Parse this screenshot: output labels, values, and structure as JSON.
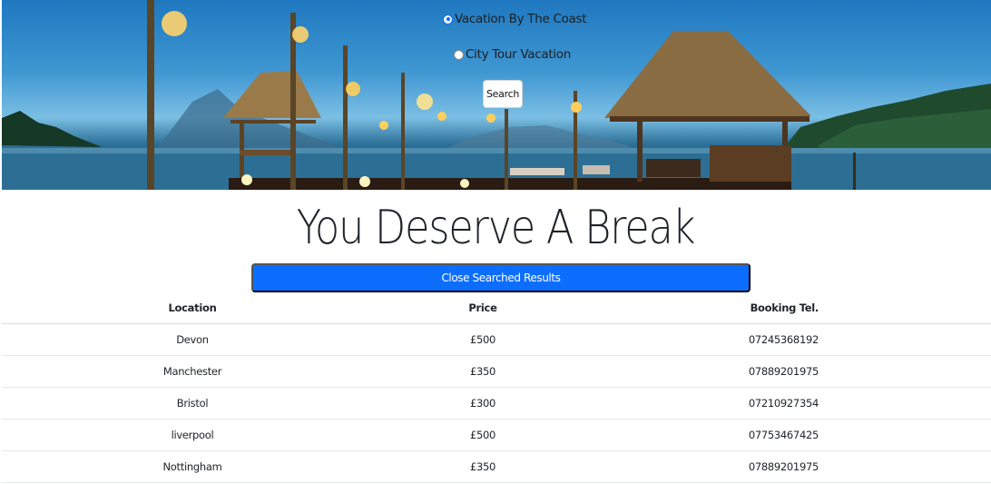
{
  "hero": {
    "options": [
      {
        "label": "Vacation By The Coast",
        "checked": true
      },
      {
        "label": "City Tour Vacation",
        "checked": false
      }
    ],
    "search_label": "Search"
  },
  "heading": "You Deserve A Break",
  "close_label": "Close Searched Results",
  "table": {
    "headers": [
      "Location",
      "Price",
      "Booking Tel."
    ],
    "rows": [
      [
        "Devon",
        "£500",
        "07245368192"
      ],
      [
        "Manchester",
        "£350",
        "07889201975"
      ],
      [
        "Bristol",
        "£300",
        "07210927354"
      ],
      [
        "liverpool",
        "£500",
        "07753467425"
      ],
      [
        "Nottingham",
        "£350",
        "07889201975"
      ]
    ]
  },
  "colors": {
    "accent": "#0d6efd",
    "sky": "#3f97d2",
    "sea": "#2c6f97"
  }
}
